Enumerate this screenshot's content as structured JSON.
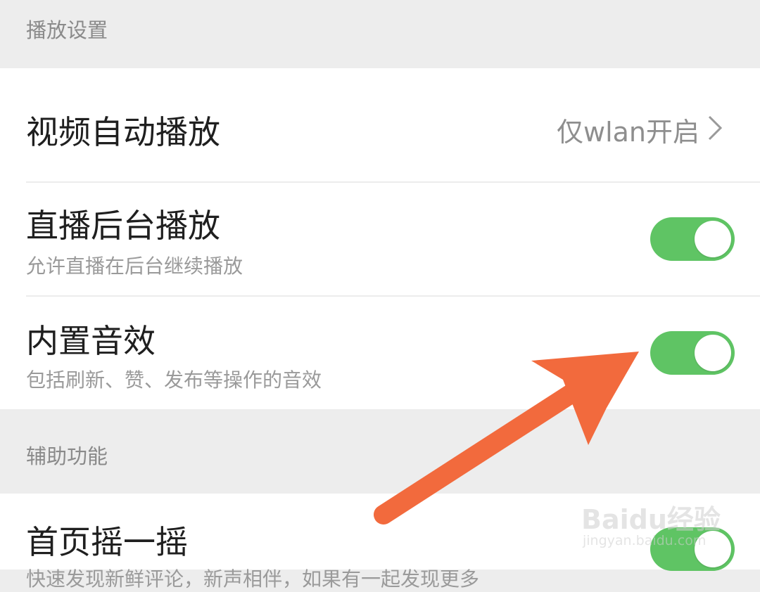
{
  "sections": {
    "playback": {
      "header": "播放设置",
      "video_autoplay": {
        "label": "视频自动播放",
        "value": "仅wlan开启"
      },
      "live_background": {
        "label": "直播后台播放",
        "description": "允许直播在后台继续播放",
        "enabled": true
      },
      "builtin_sound": {
        "label": "内置音效",
        "description": "包括刷新、赞、发布等操作的音效",
        "enabled": true
      }
    },
    "accessibility": {
      "header": "辅助功能",
      "shake_home": {
        "label": "首页摇一摇",
        "description": "快速发现新鲜评论，新声相伴，如果有一起发现更多",
        "enabled": true
      }
    }
  },
  "colors": {
    "toggle_on": "#5fc464",
    "annotation_arrow": "#f26a3d",
    "background": "#ededed"
  },
  "watermark": {
    "logo": "Baidu经验",
    "url": "jingyan.baidu.com"
  }
}
